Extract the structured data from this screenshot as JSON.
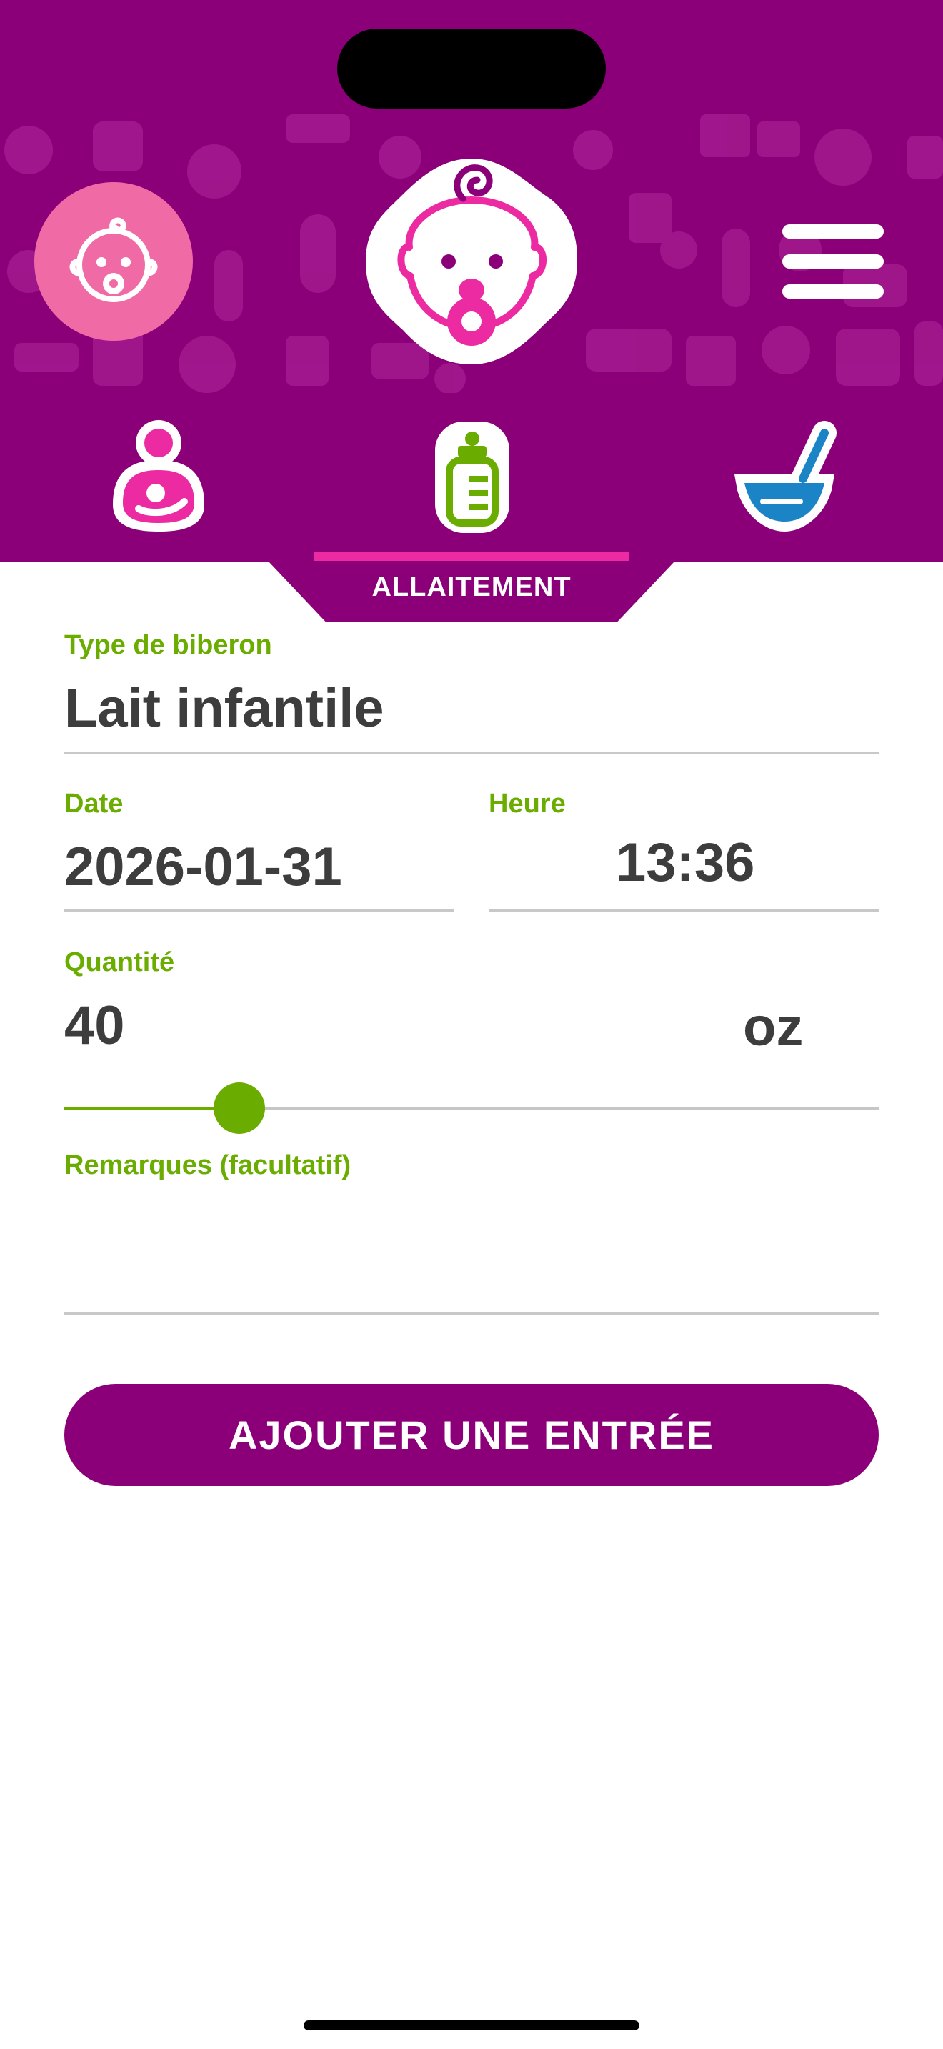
{
  "colors": {
    "header": "#8b0079",
    "accent_pink": "#ec2aa1",
    "baby_button": "#f06aa5",
    "label_green": "#6aac00",
    "value_text": "#3d3d3d",
    "feeding_blue": "#1a84c6"
  },
  "header": {
    "profile_icon": "baby-face-icon",
    "logo_icon": "baby-pacifier-logo-icon",
    "menu_icon": "hamburger-menu-icon"
  },
  "categories": [
    {
      "icon": "breastfeeding-icon"
    },
    {
      "icon": "baby-bottle-icon"
    },
    {
      "icon": "food-bowl-icon"
    }
  ],
  "tab": {
    "label": "ALLAITEMENT"
  },
  "form": {
    "bottle_type": {
      "label": "Type de biberon",
      "value": "Lait infantile"
    },
    "date": {
      "label": "Date",
      "value": "2026-01-31"
    },
    "time": {
      "label": "Heure",
      "value": "13:36"
    },
    "quantity": {
      "label": "Quantité",
      "value": "40",
      "unit": "oz",
      "slider_fraction": 0.215
    },
    "notes": {
      "label": "Remarques (facultatif)",
      "value": ""
    }
  },
  "submit_label": "AJOUTER UNE ENTRÉE"
}
